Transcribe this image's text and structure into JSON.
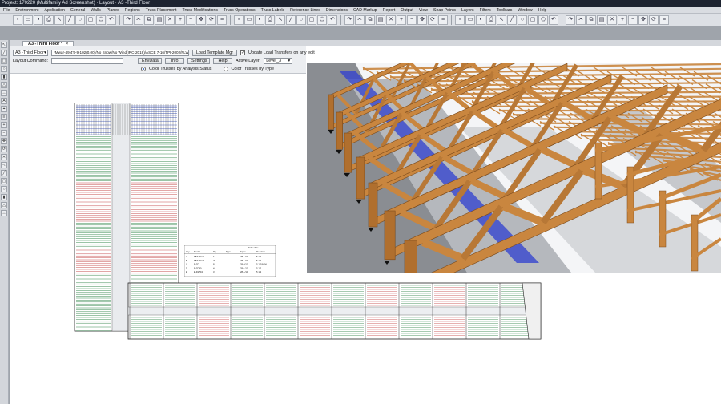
{
  "window": {
    "title": "Project: 170220 (Multifamily Ad Screenshot) · Layout · A3 -Third Floor"
  },
  "menu": [
    "File",
    "Environment",
    "Application",
    "General",
    "Walls",
    "Planes",
    "Regions",
    "Truss Placement",
    "Truss Modifications",
    "Truss Operations",
    "Truss Labels",
    "Reference Lines",
    "Dimensions",
    "CAD Markup",
    "Report",
    "Output",
    "View",
    "Snap Points",
    "Layers",
    "Filters",
    "Toolbars",
    "Window",
    "Help"
  ],
  "document_tab": {
    "label": "A3 -Third Floor *",
    "close": "×"
  },
  "panel": {
    "view_select": "A3 -Third Floor",
    "path_field": "*Mwar-49 4'5-9-102(0.00)/No Snow/No Wind(IRC-2018)/ASCE 7-16/TPI-2002/FLWood",
    "load_template_button": "Load Template Mgr",
    "update_load_transfer_label": "Update Load Transfers on any edit",
    "layout_command_label": "Layout Command:",
    "layout_command_value": "",
    "env_data_button": "EnvData",
    "info_button": "Info",
    "settings_button": "Settings",
    "help_button": "Help",
    "active_layer_label": "Active Layer:",
    "active_layer_value": "Level_3",
    "radio_analysis_label": "Color Trusses by Analysis Status",
    "radio_type_label": "Color Trusses by Type"
  },
  "schedule": {
    "headers": [
      "Qty",
      "Model",
      "Ply",
      "Type",
      "Span",
      "Reaction"
    ],
    "subtitle": "Schedule",
    "rows": [
      [
        "A",
        "FBA2D4-1",
        "14",
        "",
        "28-1/10",
        "5 1/2"
      ],
      [
        "B",
        "FBA2D4-4",
        "48",
        "",
        "28-1/10",
        "5 1/2"
      ],
      [
        "C",
        "E-2D",
        "8",
        "",
        "28-0/10",
        "5 1/2(MIN)"
      ],
      [
        "D",
        "E-2D40",
        "4",
        "",
        "28-1/10",
        "5 1/2"
      ],
      [
        "E",
        "E-DWS3",
        "3",
        "",
        "28-1/10",
        "5 1/2"
      ]
    ]
  },
  "colors": {
    "timber": "#c9863f",
    "timber_dark": "#7a4a1c",
    "beam_blue": "#2f3fd0",
    "plan_green": "#1f7a3a",
    "plan_red": "#c0393b",
    "plan_blue": "#2d48b8"
  },
  "icons": {
    "toolbar1": [
      "new-file-icon",
      "open-file-icon",
      "save-icon",
      "print-icon",
      "pointer-icon",
      "line-icon",
      "circle-icon",
      "rectangle-icon",
      "polygon-icon",
      "undo-icon",
      "redo-icon",
      "cut-icon",
      "copy-icon",
      "paste-icon",
      "delete-icon",
      "zoom-in-icon",
      "zoom-out-icon",
      "pan-icon",
      "rotate-icon",
      "layers-icon"
    ],
    "toolbar2": [
      "truss-icon",
      "wall-icon",
      "plane-icon",
      "region-icon",
      "label-icon",
      "dimension-icon",
      "snap-icon",
      "filter-icon",
      "3d-view-icon",
      "plan-view-icon"
    ]
  }
}
